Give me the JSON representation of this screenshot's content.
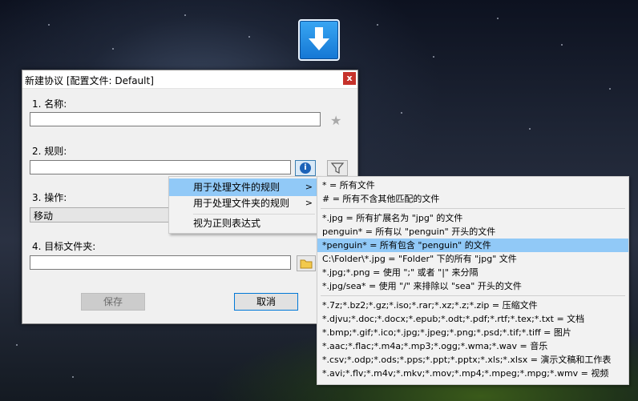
{
  "dialog": {
    "title": "新建协议 [配置文件: Default]",
    "close": "x",
    "name_label": "1.  名称:",
    "name_value": "",
    "rule_label": "2.  规则:",
    "rule_value": "",
    "action_label": "3.  操作:",
    "action_value": "移动",
    "target_label": "4.  目标文件夹:",
    "target_value": "",
    "save_label": "保存",
    "cancel_label": "取消",
    "info_glyph": "i"
  },
  "menu": {
    "items": [
      {
        "label": "用于处理文件的规则",
        "arrow": ">"
      },
      {
        "label": "用于处理文件夹的规则",
        "arrow": ">"
      },
      {
        "label": "视为正则表达式"
      }
    ]
  },
  "submenu": {
    "items": [
      "* = 所有文件",
      "# = 所有不含其他匹配的文件",
      "*.jpg = 所有扩展名为 \"jpg\" 的文件",
      "penguin* = 所有以 \"penguin\" 开头的文件",
      "*penguin* = 所有包含 \"penguin\" 的文件",
      "C:\\Folder\\*.jpg = \"Folder\" 下的所有 \"jpg\" 文件",
      "*.jpg;*.png = 使用 \";\" 或者 \"|\" 来分隔",
      "*.jpg/sea* = 使用 \"/\" 来排除以 \"sea\" 开头的文件",
      "*.7z;*.bz2;*.gz;*.iso;*.rar;*.xz;*.z;*.zip = 压缩文件",
      "*.djvu;*.doc;*.docx;*.epub;*.odt;*.pdf;*.rtf;*.tex;*.txt = 文档",
      "*.bmp;*.gif;*.ico;*.jpg;*.jpeg;*.png;*.psd;*.tif;*.tiff = 图片",
      "*.aac;*.flac;*.m4a;*.mp3;*.ogg;*.wma;*.wav = 音乐",
      "*.csv;*.odp;*.ods;*.pps;*.ppt;*.pptx;*.xls;*.xlsx = 演示文稿和工作表",
      "*.avi;*.flv;*.m4v;*.mkv;*.mov;*.mp4;*.mpeg;*.mpg;*.wmv = 视频"
    ]
  },
  "colors": {
    "highlight": "#91c9f7",
    "close": "#c6322b",
    "focus_border": "#0078d7"
  },
  "icons": {
    "desktop": "download-arrow-icon",
    "favorite": "star-icon",
    "info": "info-icon",
    "filter": "funnel-icon",
    "browse": "folder-icon"
  }
}
